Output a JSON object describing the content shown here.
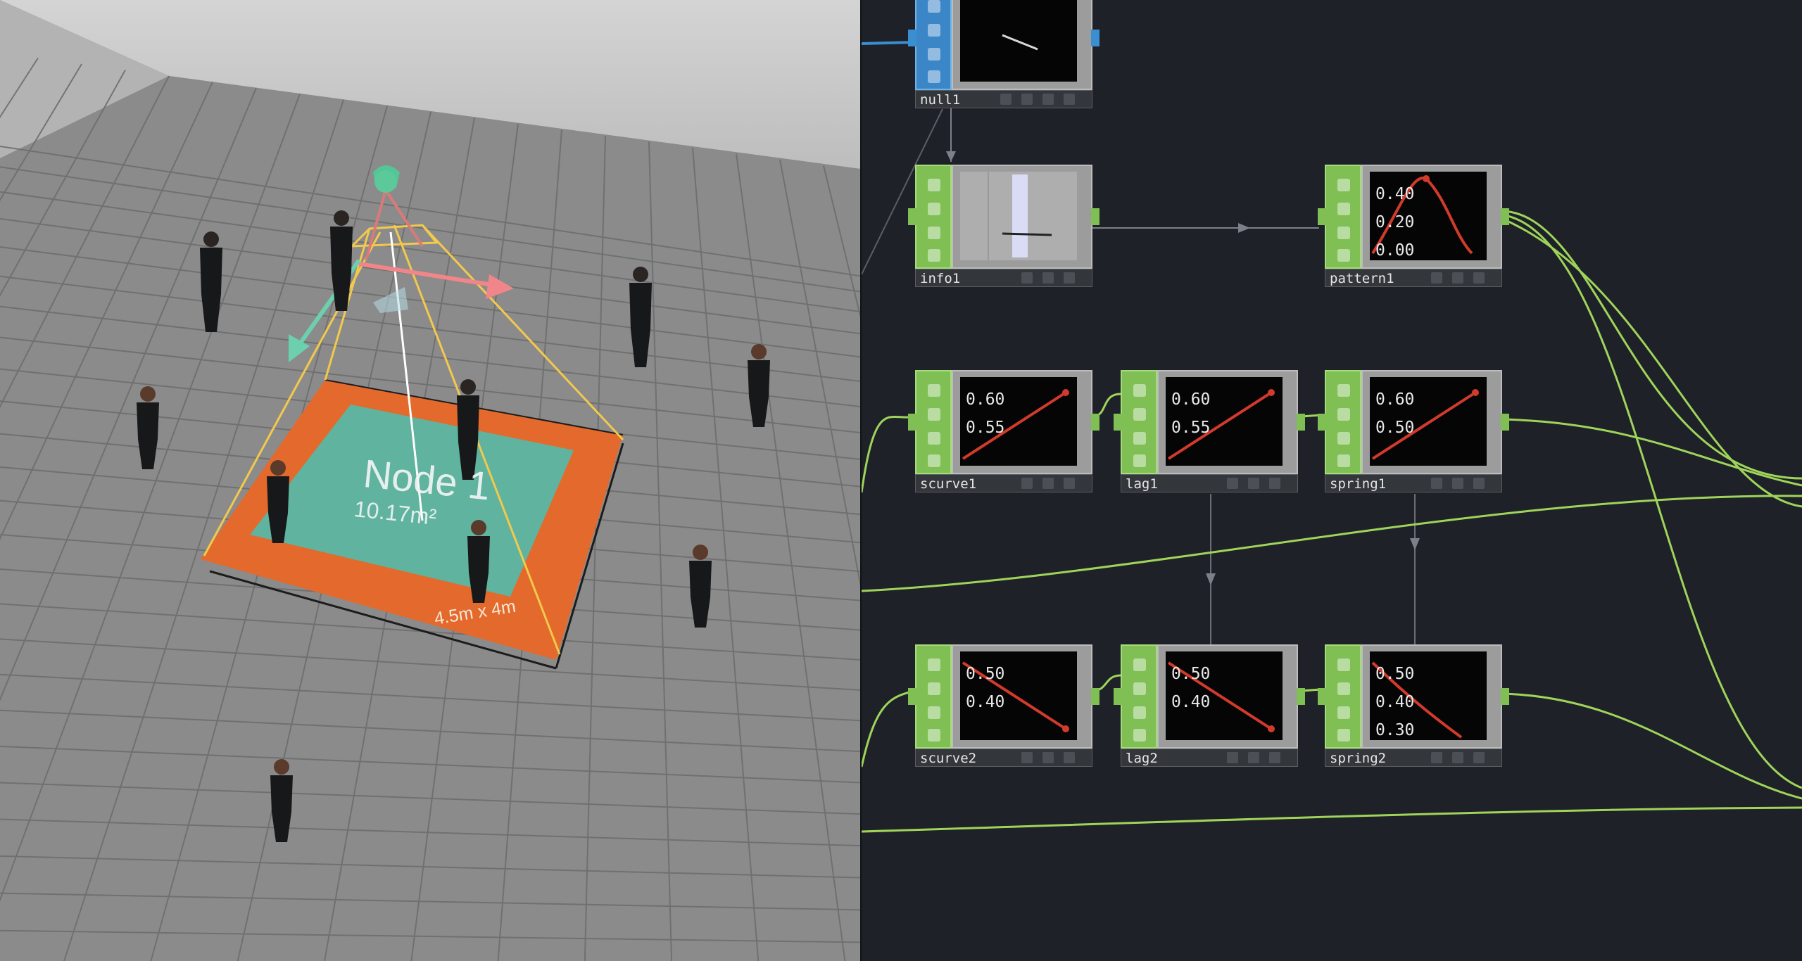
{
  "scene": {
    "node_title": "Node 1",
    "node_area": "10.17m²",
    "node_size": "4.5m x 4m",
    "colors": {
      "floor": "#8a8a8a",
      "grid": "#6c6c6c",
      "wall": "#c6c6c6",
      "mat_outer": "#e36a2c",
      "mat_inner": "#5ab6a2",
      "frustum": "#f2c94c",
      "arrow_red": "#f0868a",
      "arrow_green": "#6cd0ae"
    }
  },
  "network": {
    "nodes": [
      {
        "id": "null1",
        "label": "null1",
        "type": "null",
        "values": []
      },
      {
        "id": "info1",
        "label": "info1",
        "type": "info",
        "values": []
      },
      {
        "id": "pattern1",
        "label": "pattern1",
        "type": "chart",
        "values": [
          "0.40",
          "0.20",
          "0.00"
        ]
      },
      {
        "id": "scurve1",
        "label": "scurve1",
        "type": "chart",
        "values": [
          "0.60",
          "0.55"
        ]
      },
      {
        "id": "lag1",
        "label": "lag1",
        "type": "chart",
        "values": [
          "0.60",
          "0.55"
        ]
      },
      {
        "id": "spring1",
        "label": "spring1",
        "type": "chart",
        "values": [
          "0.60",
          "0.50"
        ]
      },
      {
        "id": "scurve2",
        "label": "scurve2",
        "type": "chart",
        "values": [
          "0.50",
          "0.40"
        ]
      },
      {
        "id": "lag2",
        "label": "lag2",
        "type": "chart",
        "values": [
          "0.50",
          "0.40"
        ]
      },
      {
        "id": "spring2",
        "label": "spring2",
        "type": "chart",
        "values": [
          "0.50",
          "0.40",
          "0.30"
        ]
      }
    ],
    "colors": {
      "chop_green": "#7fbf54",
      "null_blue": "#3b86c6",
      "wire_green": "#9fd45a",
      "curve_red": "#d23a2c",
      "background": "#1e2128"
    }
  }
}
